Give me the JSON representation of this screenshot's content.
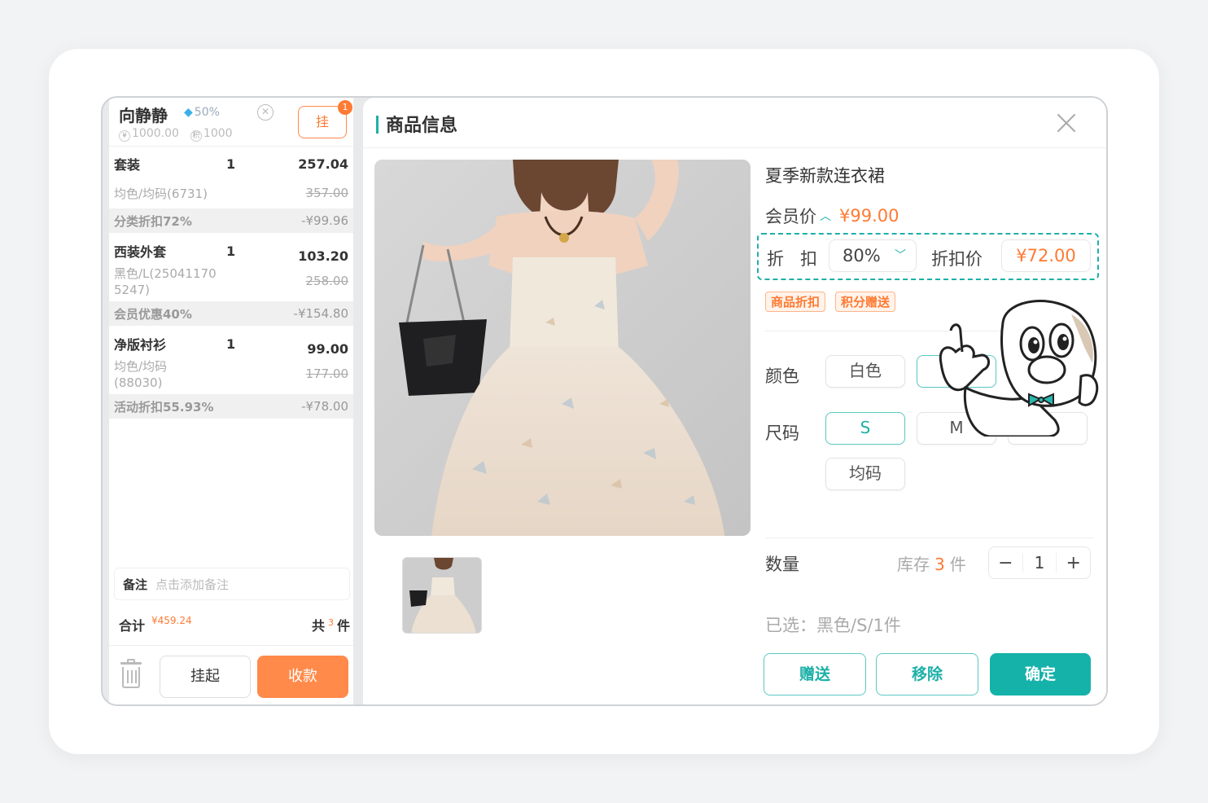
{
  "member": {
    "name": "向静静",
    "vip_discount": "50%",
    "balance": "1000.00",
    "points": "1000",
    "balance_icon_label": "¥",
    "points_icon_label": "积"
  },
  "hang_button": {
    "label": "挂",
    "badge": "1"
  },
  "cart": [
    {
      "name": "套装",
      "qty": "1",
      "price": "257.04",
      "spec": "均色/均码(6731)",
      "orig_price": "357.00",
      "discount_label": "分类折扣72%",
      "discount_value": "-¥99.96"
    },
    {
      "name": "西装外套",
      "qty": "1",
      "price": "103.20",
      "spec": "黑色/L(25041170 5247)",
      "orig_price": "258.00",
      "discount_label": "会员优惠40%",
      "discount_value": "-¥154.80"
    },
    {
      "name": "净版衬衫",
      "qty": "1",
      "price": "99.00",
      "spec": "均色/均码 (88030)",
      "orig_price": "177.00",
      "discount_label": "活动折扣55.93%",
      "discount_value": "-¥78.00"
    }
  ],
  "remark": {
    "label": "备注",
    "placeholder": "点击添加备注"
  },
  "total": {
    "label": "合计",
    "amount": "¥459.24",
    "count_prefix": "共",
    "count": "3",
    "count_suffix": "件"
  },
  "left_actions": {
    "hang": "挂起",
    "pay": "收款"
  },
  "panel": {
    "title": "商品信息",
    "product_name": "夏季新款连衣裙",
    "member_price_label": "会员价",
    "member_price": "¥99.00",
    "discount_label": "折扣",
    "discount_value": "80%",
    "discount_price_label": "折扣价",
    "discount_price": "¥72.00",
    "tags": [
      "商品折扣",
      "积分赠送"
    ],
    "color_label": "颜色",
    "colors": [
      "白色",
      ""
    ],
    "size_label": "尺码",
    "sizes": [
      "S",
      "M",
      "L",
      "均码"
    ],
    "selected_size": "S",
    "qty_label": "数量",
    "stock_prefix": "库存",
    "stock": "3",
    "stock_suffix": "件",
    "qty": "1",
    "selected_summary": "已选：黑色/S/1件",
    "buttons": {
      "gift": "赠送",
      "remove": "移除",
      "confirm": "确定"
    }
  },
  "colors": {
    "accent": "#15b2aa",
    "orange": "#ff7a33"
  },
  "icons": [
    "diamond-icon",
    "close-circle-icon",
    "wallet-icon",
    "points-icon",
    "trash-icon",
    "close-icon",
    "chevron-up-icon",
    "chevron-down-icon",
    "minus-icon",
    "plus-icon"
  ]
}
